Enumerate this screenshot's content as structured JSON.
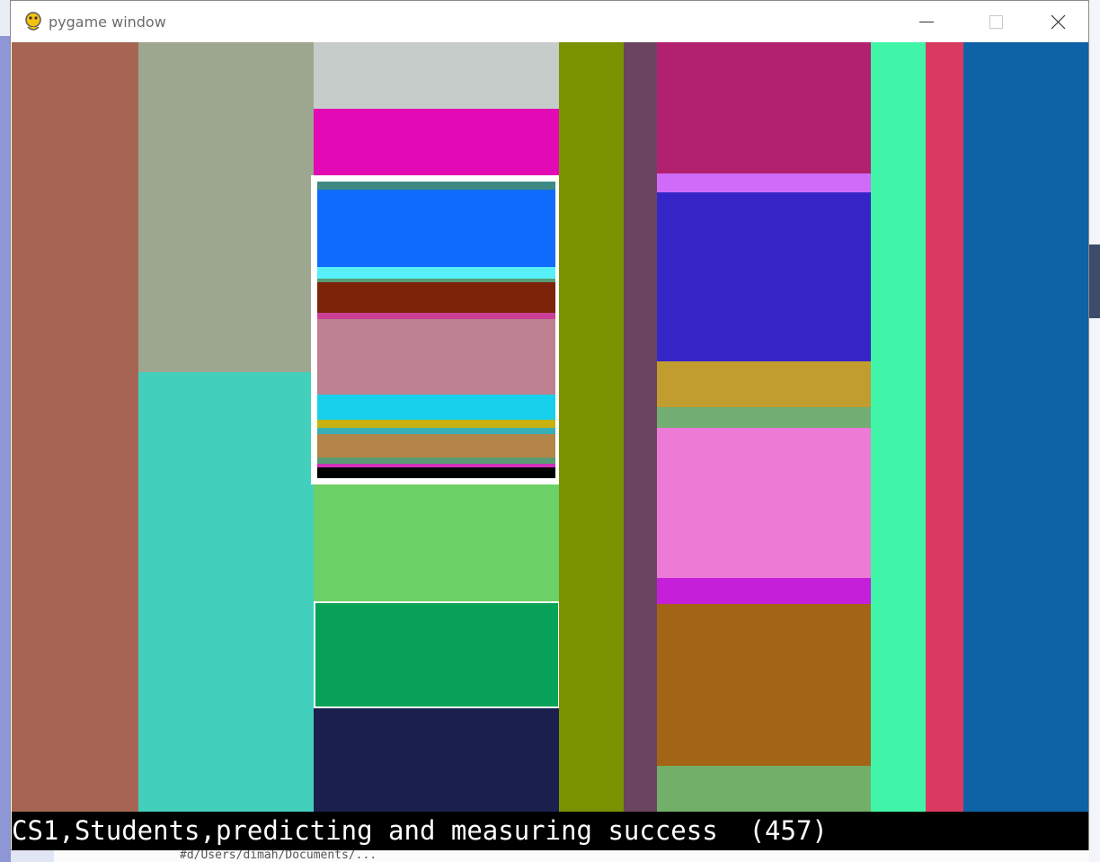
{
  "window": {
    "title": "pygame window",
    "icons": {
      "app": "pygame-snake-icon",
      "minimize": "minimize-icon",
      "maximize": "maximize-icon",
      "close": "close-icon"
    }
  },
  "status": {
    "text": "CS1,Students,predicting and measuring success  (457)"
  },
  "background": {
    "partial_text": "#d/Users/dimah/Documents/..."
  },
  "treemap": {
    "colors": {
      "c1": "#a66653",
      "c2": "#9da68f",
      "c3": "#42cfbc",
      "c4": "#c6ccca",
      "c5": "#e10ab4",
      "c6": "#6bd166",
      "c7": "#08a359",
      "c8": "#1b1f4e",
      "c9": "#7a9200",
      "c10": "#6b4560",
      "c11": "#b2216f",
      "c12": "#cf6bf8",
      "c13": "#3625c6",
      "c14": "#c19c2f",
      "c15": "#72ad74",
      "c16": "#ed7bd6",
      "c17": "#c51fd9",
      "c18": "#a46415",
      "c19": "#72af69",
      "c20": "#41f5a8",
      "c21": "#da3a5f",
      "c22": "#0e62a6",
      "s1": "#3c8a83",
      "s2": "#106cfc",
      "s3": "#58f0f8",
      "s4": "#7d2309",
      "s5": "#cc3f97",
      "s6": "#bd8090",
      "s7": "#17d1ec",
      "s8": "#c7b211",
      "s9": "#3ab0b6",
      "s10": "#b48548",
      "s11": "#5a9a74",
      "s12": "#d030b9",
      "s13": "#000000"
    }
  }
}
